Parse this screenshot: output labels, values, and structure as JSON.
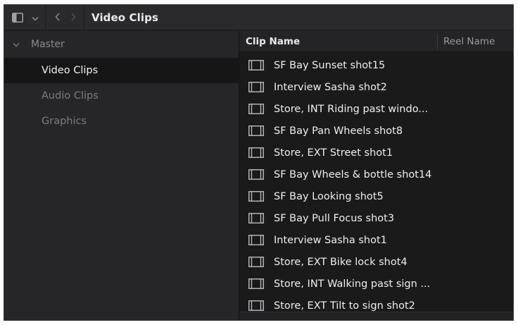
{
  "toolbar": {
    "title": "Video Clips",
    "icons": {
      "sidebar_toggle": "sidebar-toggle-icon",
      "dropdown": "chevron-down-icon",
      "back": "chevron-left-icon",
      "forward": "chevron-right-icon"
    }
  },
  "sidebar": {
    "root": {
      "label": "Master",
      "expanded": true
    },
    "items": [
      {
        "label": "Video Clips",
        "selected": true
      },
      {
        "label": "Audio Clips",
        "selected": false
      },
      {
        "label": "Graphics",
        "selected": false
      }
    ]
  },
  "list": {
    "columns": [
      {
        "label": "Clip Name"
      },
      {
        "label": "Reel Name"
      }
    ],
    "clips": [
      {
        "name": "SF Bay Sunset shot15",
        "reel": ""
      },
      {
        "name": "Interview Sasha shot2",
        "reel": ""
      },
      {
        "name": "Store, INT Riding past windo...",
        "reel": ""
      },
      {
        "name": "SF Bay Pan Wheels shot8",
        "reel": ""
      },
      {
        "name": "Store, EXT Street shot1",
        "reel": ""
      },
      {
        "name": "SF Bay Wheels & bottle shot14",
        "reel": ""
      },
      {
        "name": "SF Bay Looking shot5",
        "reel": ""
      },
      {
        "name": "SF Bay Pull Focus shot3",
        "reel": ""
      },
      {
        "name": "Interview Sasha shot1",
        "reel": ""
      },
      {
        "name": "Store, EXT Bike lock shot4",
        "reel": ""
      },
      {
        "name": "Store, INT Walking past sign ...",
        "reel": ""
      },
      {
        "name": "Store, EXT Tilt to sign shot2",
        "reel": ""
      }
    ],
    "clip_icon": "film-clip-icon"
  },
  "colors": {
    "window_bg": "#242426",
    "list_bg": "#1a1a1b",
    "selected_bg": "#161617",
    "text_primary": "#eeeeee",
    "text_muted": "#7c7c80"
  }
}
